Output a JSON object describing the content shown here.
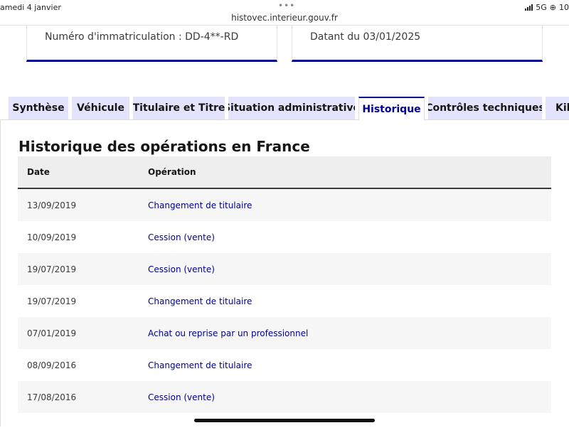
{
  "status_bar": {
    "date": "amedi 4 janvier",
    "dots": "•••",
    "url": "histovec.interieur.gouv.fr",
    "network": "5G",
    "battery_partial": "10"
  },
  "cards": {
    "plate": "Numéro d'immatriculation : DD-4**-RD",
    "date": "Datant du 03/01/2025"
  },
  "tabs": [
    {
      "label": "Synthèse",
      "active": false
    },
    {
      "label": "Véhicule",
      "active": false
    },
    {
      "label": "Titulaire et Titre",
      "active": false
    },
    {
      "label": "Situation administrative",
      "active": false
    },
    {
      "label": "Historique",
      "active": true
    },
    {
      "label": "Contrôles techniques",
      "active": false
    },
    {
      "label": "Kilo",
      "active": false
    }
  ],
  "history": {
    "title": "Historique des opérations en France",
    "columns": {
      "date": "Date",
      "operation": "Opération"
    },
    "rows": [
      {
        "date": "13/09/2019",
        "operation": "Changement de titulaire"
      },
      {
        "date": "10/09/2019",
        "operation": "Cession (vente)"
      },
      {
        "date": "19/07/2019",
        "operation": "Cession (vente)"
      },
      {
        "date": "19/07/2019",
        "operation": "Changement de titulaire"
      },
      {
        "date": "07/01/2019",
        "operation": "Achat ou reprise par un professionnel"
      },
      {
        "date": "08/09/2016",
        "operation": "Changement de titulaire"
      },
      {
        "date": "17/08/2016",
        "operation": "Cession (vente)"
      },
      {
        "date": "",
        "operation": ""
      }
    ]
  },
  "colors": {
    "accent": "#000091",
    "tab_inactive_bg": "#e3e3fd",
    "row_alt_bg": "#f6f6f6"
  }
}
